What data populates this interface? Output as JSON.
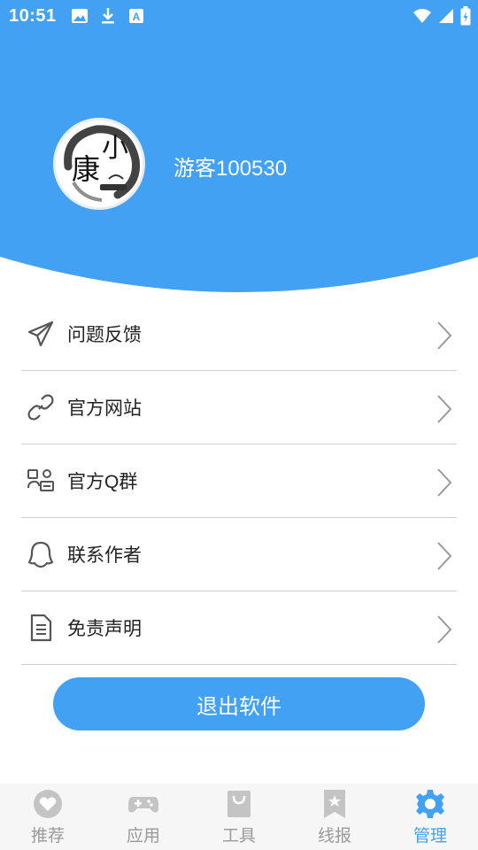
{
  "status_bar": {
    "time": "10:51",
    "left_icons": [
      "image-icon",
      "download-icon",
      "font-icon"
    ],
    "right_icons": [
      "wifi-icon",
      "signal-icon",
      "battery-icon"
    ]
  },
  "profile": {
    "avatar_icon": "avatar-logo",
    "avatar_text": [
      "小",
      "康"
    ],
    "username": "游客100530"
  },
  "menu": [
    {
      "label": "问题反馈",
      "icon": "paper-plane-icon"
    },
    {
      "label": "官方网站",
      "icon": "link-icon"
    },
    {
      "label": "官方Q群",
      "icon": "group-icon"
    },
    {
      "label": "联系作者",
      "icon": "qq-icon"
    },
    {
      "label": "免责声明",
      "icon": "document-icon"
    }
  ],
  "logout_label": "退出软件",
  "bottom_nav": [
    {
      "label": "推荐",
      "icon": "heart-icon",
      "active": false
    },
    {
      "label": "应用",
      "icon": "gamepad-icon",
      "active": false
    },
    {
      "label": "工具",
      "icon": "bag-icon",
      "active": false
    },
    {
      "label": "线报",
      "icon": "bookmark-icon",
      "active": false
    },
    {
      "label": "管理",
      "icon": "gear-icon",
      "active": true
    }
  ],
  "colors": {
    "accent": "#42a1f2",
    "nav_inactive": "#c4c4c4",
    "divider": "#cfcfcf"
  }
}
